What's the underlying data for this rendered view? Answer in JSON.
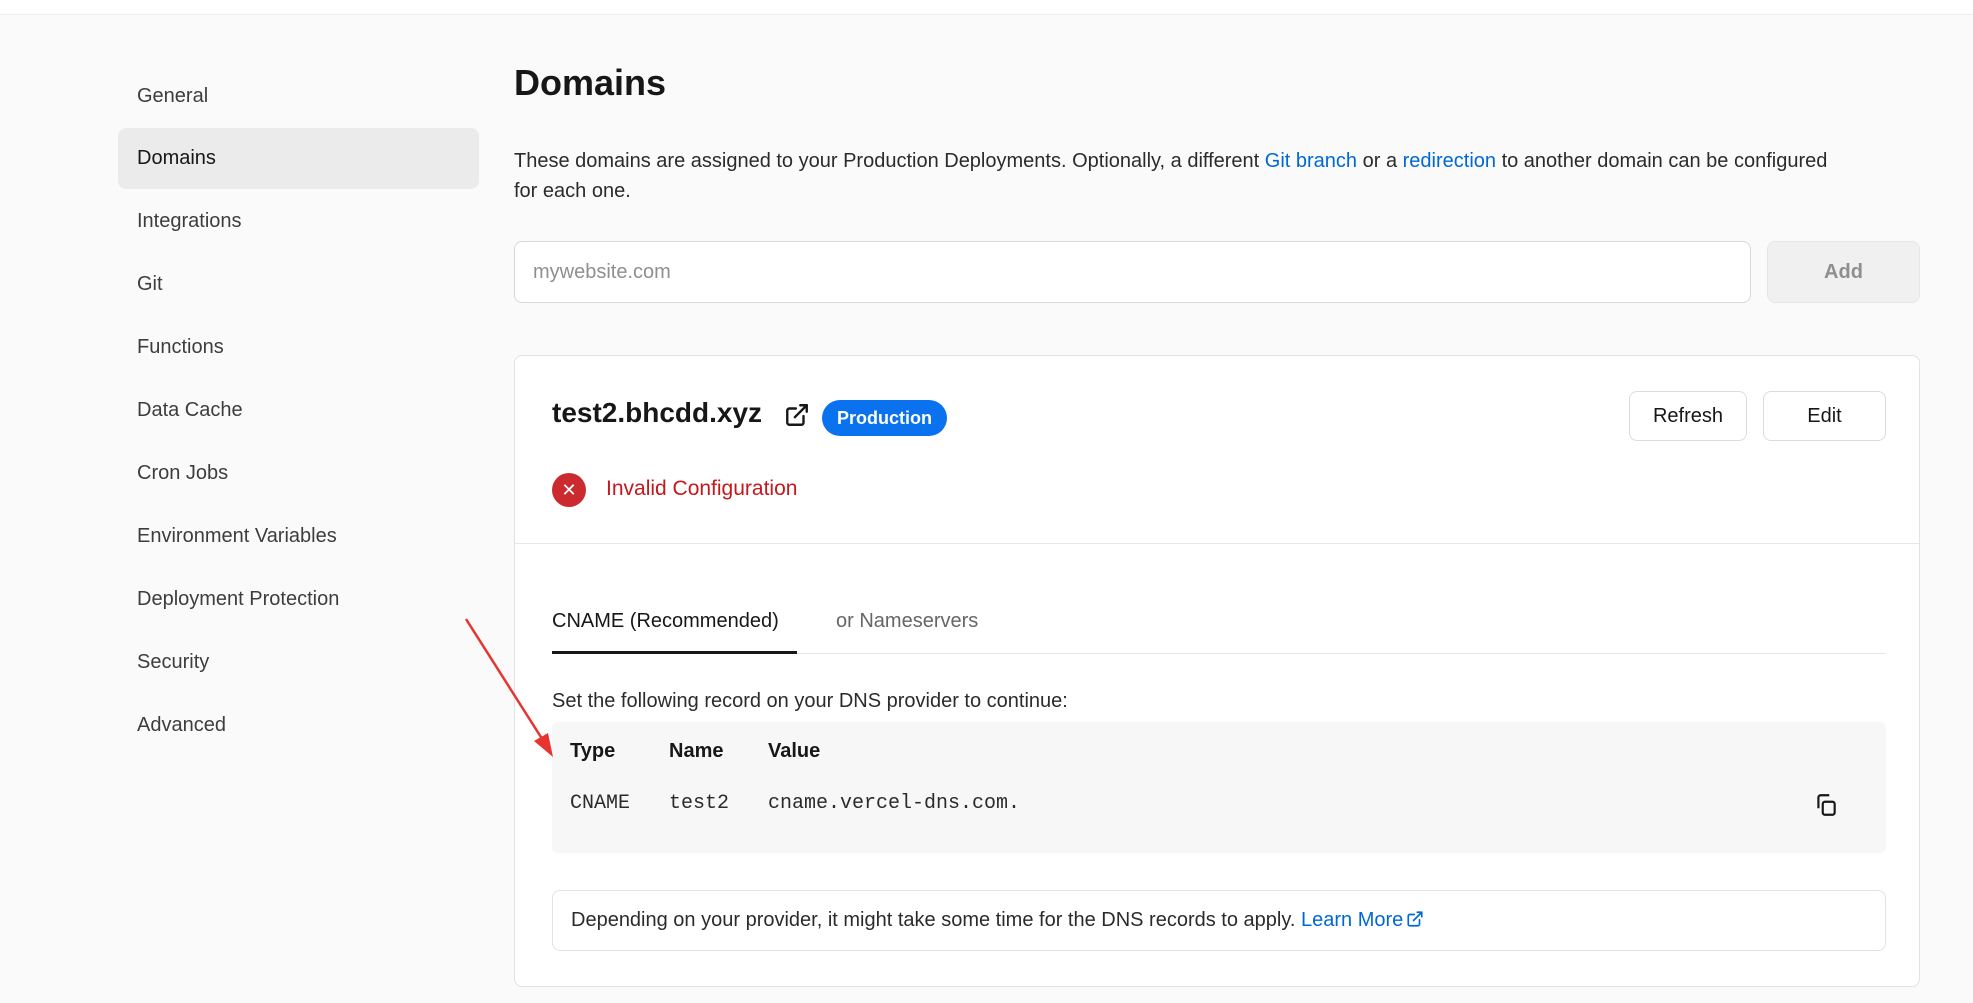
{
  "sidebar": {
    "items": [
      {
        "label": "General"
      },
      {
        "label": "Domains",
        "active": true
      },
      {
        "label": "Integrations"
      },
      {
        "label": "Git"
      },
      {
        "label": "Functions"
      },
      {
        "label": "Data Cache"
      },
      {
        "label": "Cron Jobs"
      },
      {
        "label": "Environment Variables"
      },
      {
        "label": "Deployment Protection"
      },
      {
        "label": "Security"
      },
      {
        "label": "Advanced"
      }
    ]
  },
  "main": {
    "title": "Domains",
    "intro": {
      "text_before": "These domains are assigned to your Production Deployments. Optionally, a different ",
      "git_branch_link": "Git branch",
      "text_middle": " or a ",
      "redirection_link": "redirection",
      "text_after": " to another domain can be configured for each one."
    },
    "add_domain": {
      "placeholder": "mywebsite.com",
      "value": "",
      "button_label": "Add"
    },
    "domain_card": {
      "domain": "test2.bhcdd.xyz",
      "badge": "Production",
      "refresh_label": "Refresh",
      "edit_label": "Edit",
      "status": "Invalid Configuration",
      "status_icon": "x-circle-icon",
      "tabs": [
        {
          "label": "CNAME (Recommended)",
          "active": true
        },
        {
          "label": "or Nameservers"
        }
      ],
      "instruction": "Set the following record on your DNS provider to continue:",
      "records": {
        "headers": [
          "Type",
          "Name",
          "Value"
        ],
        "rows": [
          {
            "type": "CNAME",
            "name": "test2",
            "value": "cname.vercel-dns.com."
          }
        ]
      },
      "note": {
        "text": "Depending on your provider, it might take some time for the DNS records to apply. ",
        "link": "Learn More"
      }
    }
  },
  "colors": {
    "accent": "#0068d6",
    "badge": "#0a72ef",
    "error": "#c5171c",
    "annotation_arrow": "#e8332f"
  }
}
